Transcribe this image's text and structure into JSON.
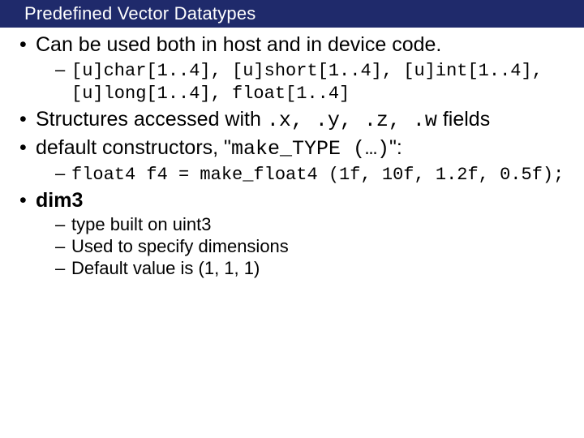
{
  "title": "Predefined Vector Datatypes",
  "b1": {
    "text": "Can be used both in host and in device code.",
    "sub1": "[u]char[1..4], [u]short[1..4], [u]int[1..4], [u]long[1..4], float[1..4]"
  },
  "b2": {
    "pre": "Structures accessed with ",
    "code": ".x, .y, .z, .w",
    "post": " fields"
  },
  "b3": {
    "pre": "default constructors, \"",
    "code": "make_TYPE (…)",
    "post": "\":",
    "sub1": "float4 f4 = make_float4 (1f, 10f, 1.2f, 0.5f);"
  },
  "b4": {
    "text": "dim3",
    "sub1": "type built on uint3",
    "sub2": "Used to specify dimensions",
    "sub3": "Default value is (1, 1, 1)"
  }
}
